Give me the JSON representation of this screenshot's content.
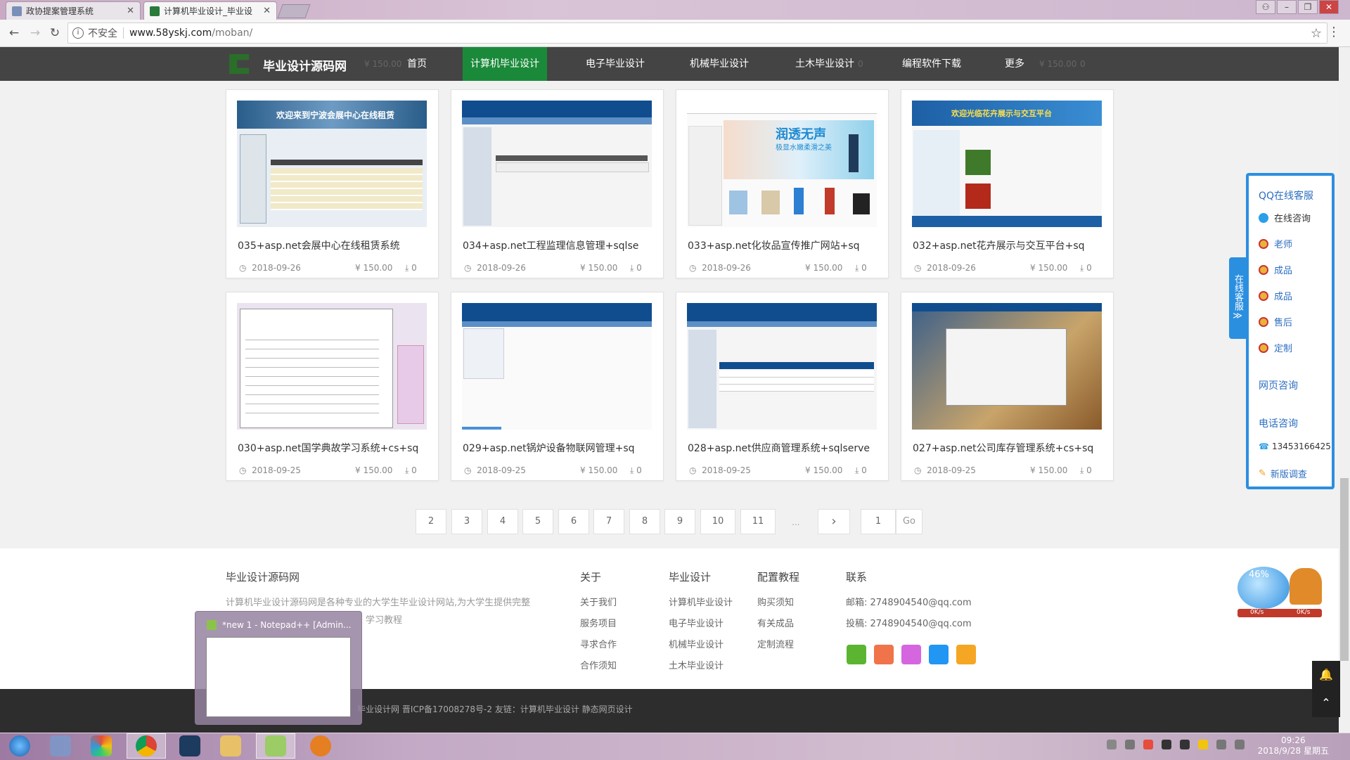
{
  "browser": {
    "tabs": [
      {
        "title": "政协提案管理系统",
        "close": "✕"
      },
      {
        "title": "计算机毕业设计_毕业设",
        "close": "✕"
      }
    ],
    "address": {
      "security": "不安全",
      "host": "www.58yskj.com",
      "path": "/moban/"
    }
  },
  "site": {
    "logo_text": "毕业设计源码网",
    "nav": [
      "首页",
      "计算机毕业设计",
      "电子毕业设计",
      "机械毕业设计",
      "土木毕业设计",
      "编程软件下载",
      "更多"
    ],
    "nav_active": "计算机毕业设计",
    "ghost_meta": {
      "price": "¥ 150.00",
      "dl": "0"
    }
  },
  "products": [
    {
      "title": "035+asp.net会展中心在线租赁系统",
      "date": "2018-09-26",
      "price": "¥ 150.00",
      "downloads": "0"
    },
    {
      "title": "034+asp.net工程监理信息管理+sqlse",
      "date": "2018-09-26",
      "price": "¥ 150.00",
      "downloads": "0"
    },
    {
      "title": "033+asp.net化妆品宣传推广网站+sq",
      "date": "2018-09-26",
      "price": "¥ 150.00",
      "downloads": "0"
    },
    {
      "title": "032+asp.net花卉展示与交互平台+sq",
      "date": "2018-09-26",
      "price": "¥ 150.00",
      "downloads": "0"
    },
    {
      "title": "030+asp.net国学典故学习系统+cs+sq",
      "date": "2018-09-25",
      "price": "¥ 150.00",
      "downloads": "0"
    },
    {
      "title": "029+asp.net锅炉设备物联网管理+sq",
      "date": "2018-09-25",
      "price": "¥ 150.00",
      "downloads": "0"
    },
    {
      "title": "028+asp.net供应商管理系统+sqlserve",
      "date": "2018-09-25",
      "price": "¥ 150.00",
      "downloads": "0"
    },
    {
      "title": "027+asp.net公司库存管理系统+cs+sq",
      "date": "2018-09-25",
      "price": "¥ 150.00",
      "downloads": "0"
    }
  ],
  "thumb_text": {
    "t1": "欢迎来到宁波会展中心在线租赁",
    "t3a": "润透无声",
    "t3b": "极显水嫩柔滑之美",
    "t4": "欢迎光临花卉展示与交互平台"
  },
  "pagination": {
    "pages": [
      "2",
      "3",
      "4",
      "5",
      "6",
      "7",
      "8",
      "9",
      "10",
      "11"
    ],
    "ellipsis": "...",
    "next": "›",
    "goto_value": "1",
    "go_label": "Go"
  },
  "footer": {
    "about_title": "毕业设计源码网",
    "about_text": [
      "计算机毕业设计源码网是各种专业的大学生毕业设计网站,为大学生提供完整",
      "学习教程"
    ],
    "columns": [
      {
        "title": "关于",
        "links": [
          "关于我们",
          "服务项目",
          "寻求合作",
          "合作须知"
        ]
      },
      {
        "title": "毕业设计",
        "links": [
          "计算机毕业设计",
          "电子毕业设计",
          "机械毕业设计",
          "土木毕业设计"
        ]
      },
      {
        "title": "配置教程",
        "links": [
          "购买须知",
          "有关成品",
          "定制流程"
        ]
      }
    ],
    "contact_title": "联系",
    "email": "邮箱: 2748904540@qq.com",
    "tougao": "投稿: 2748904540@qq.com",
    "social_colors": [
      "#5cb531",
      "#f0734a",
      "#d566e0",
      "#2196f3",
      "#f5a623"
    ],
    "copyright": "毕业设计网 晋ICP备17008278号-2 友链：计算机毕业设计 静态网页设计"
  },
  "qq_panel": {
    "title": "QQ在线客服",
    "online": "在线咨询",
    "agents": [
      "老师",
      "成品",
      "成品",
      "售后",
      "定制"
    ],
    "web_consult": "网页咨询",
    "phone_title": "电话咨询",
    "phone": "13453166425",
    "survey": "新版调查",
    "side_tab": "在线客服",
    "side_tab_arrow": "≫"
  },
  "widget": {
    "percent": "46%",
    "speed1": "0K/s",
    "speed2": "0K/s"
  },
  "taskbar_preview": {
    "title": "*new 1 - Notepad++ [Admin..."
  },
  "clock": {
    "time": "09:26",
    "date": "2018/9/28 星期五"
  },
  "colors": {
    "nav_bg": "#444444",
    "nav_active": "#1a8a3a",
    "qq_blue": "#2b8fe0"
  }
}
